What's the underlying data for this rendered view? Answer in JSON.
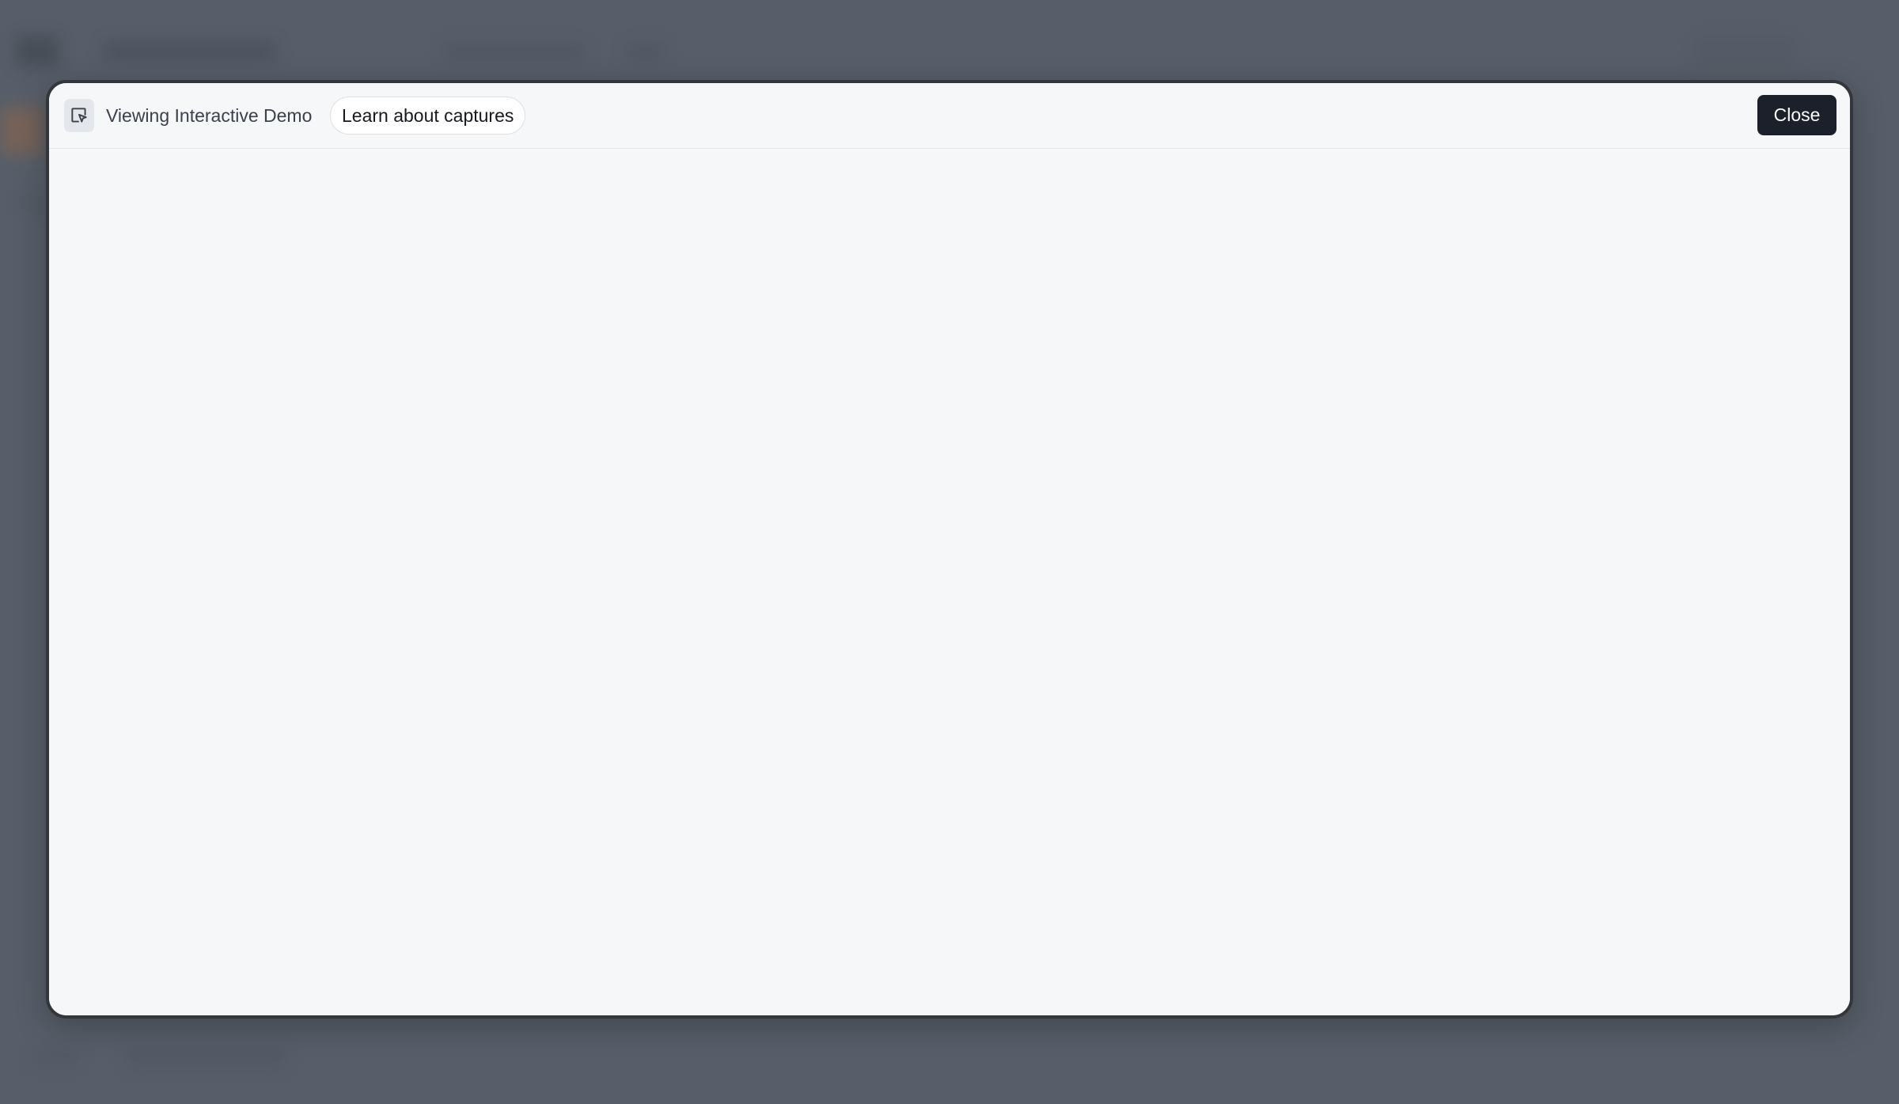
{
  "header": {
    "icon": "cursor-click-icon",
    "label": "Viewing Interactive Demo",
    "learn_button_label": "Learn about captures",
    "close_button_label": "Close"
  },
  "colors": {
    "backdrop": "#575e69",
    "modal_background": "#f6f7f9",
    "modal_border": "#33373d",
    "close_button_background": "#1b202b"
  }
}
